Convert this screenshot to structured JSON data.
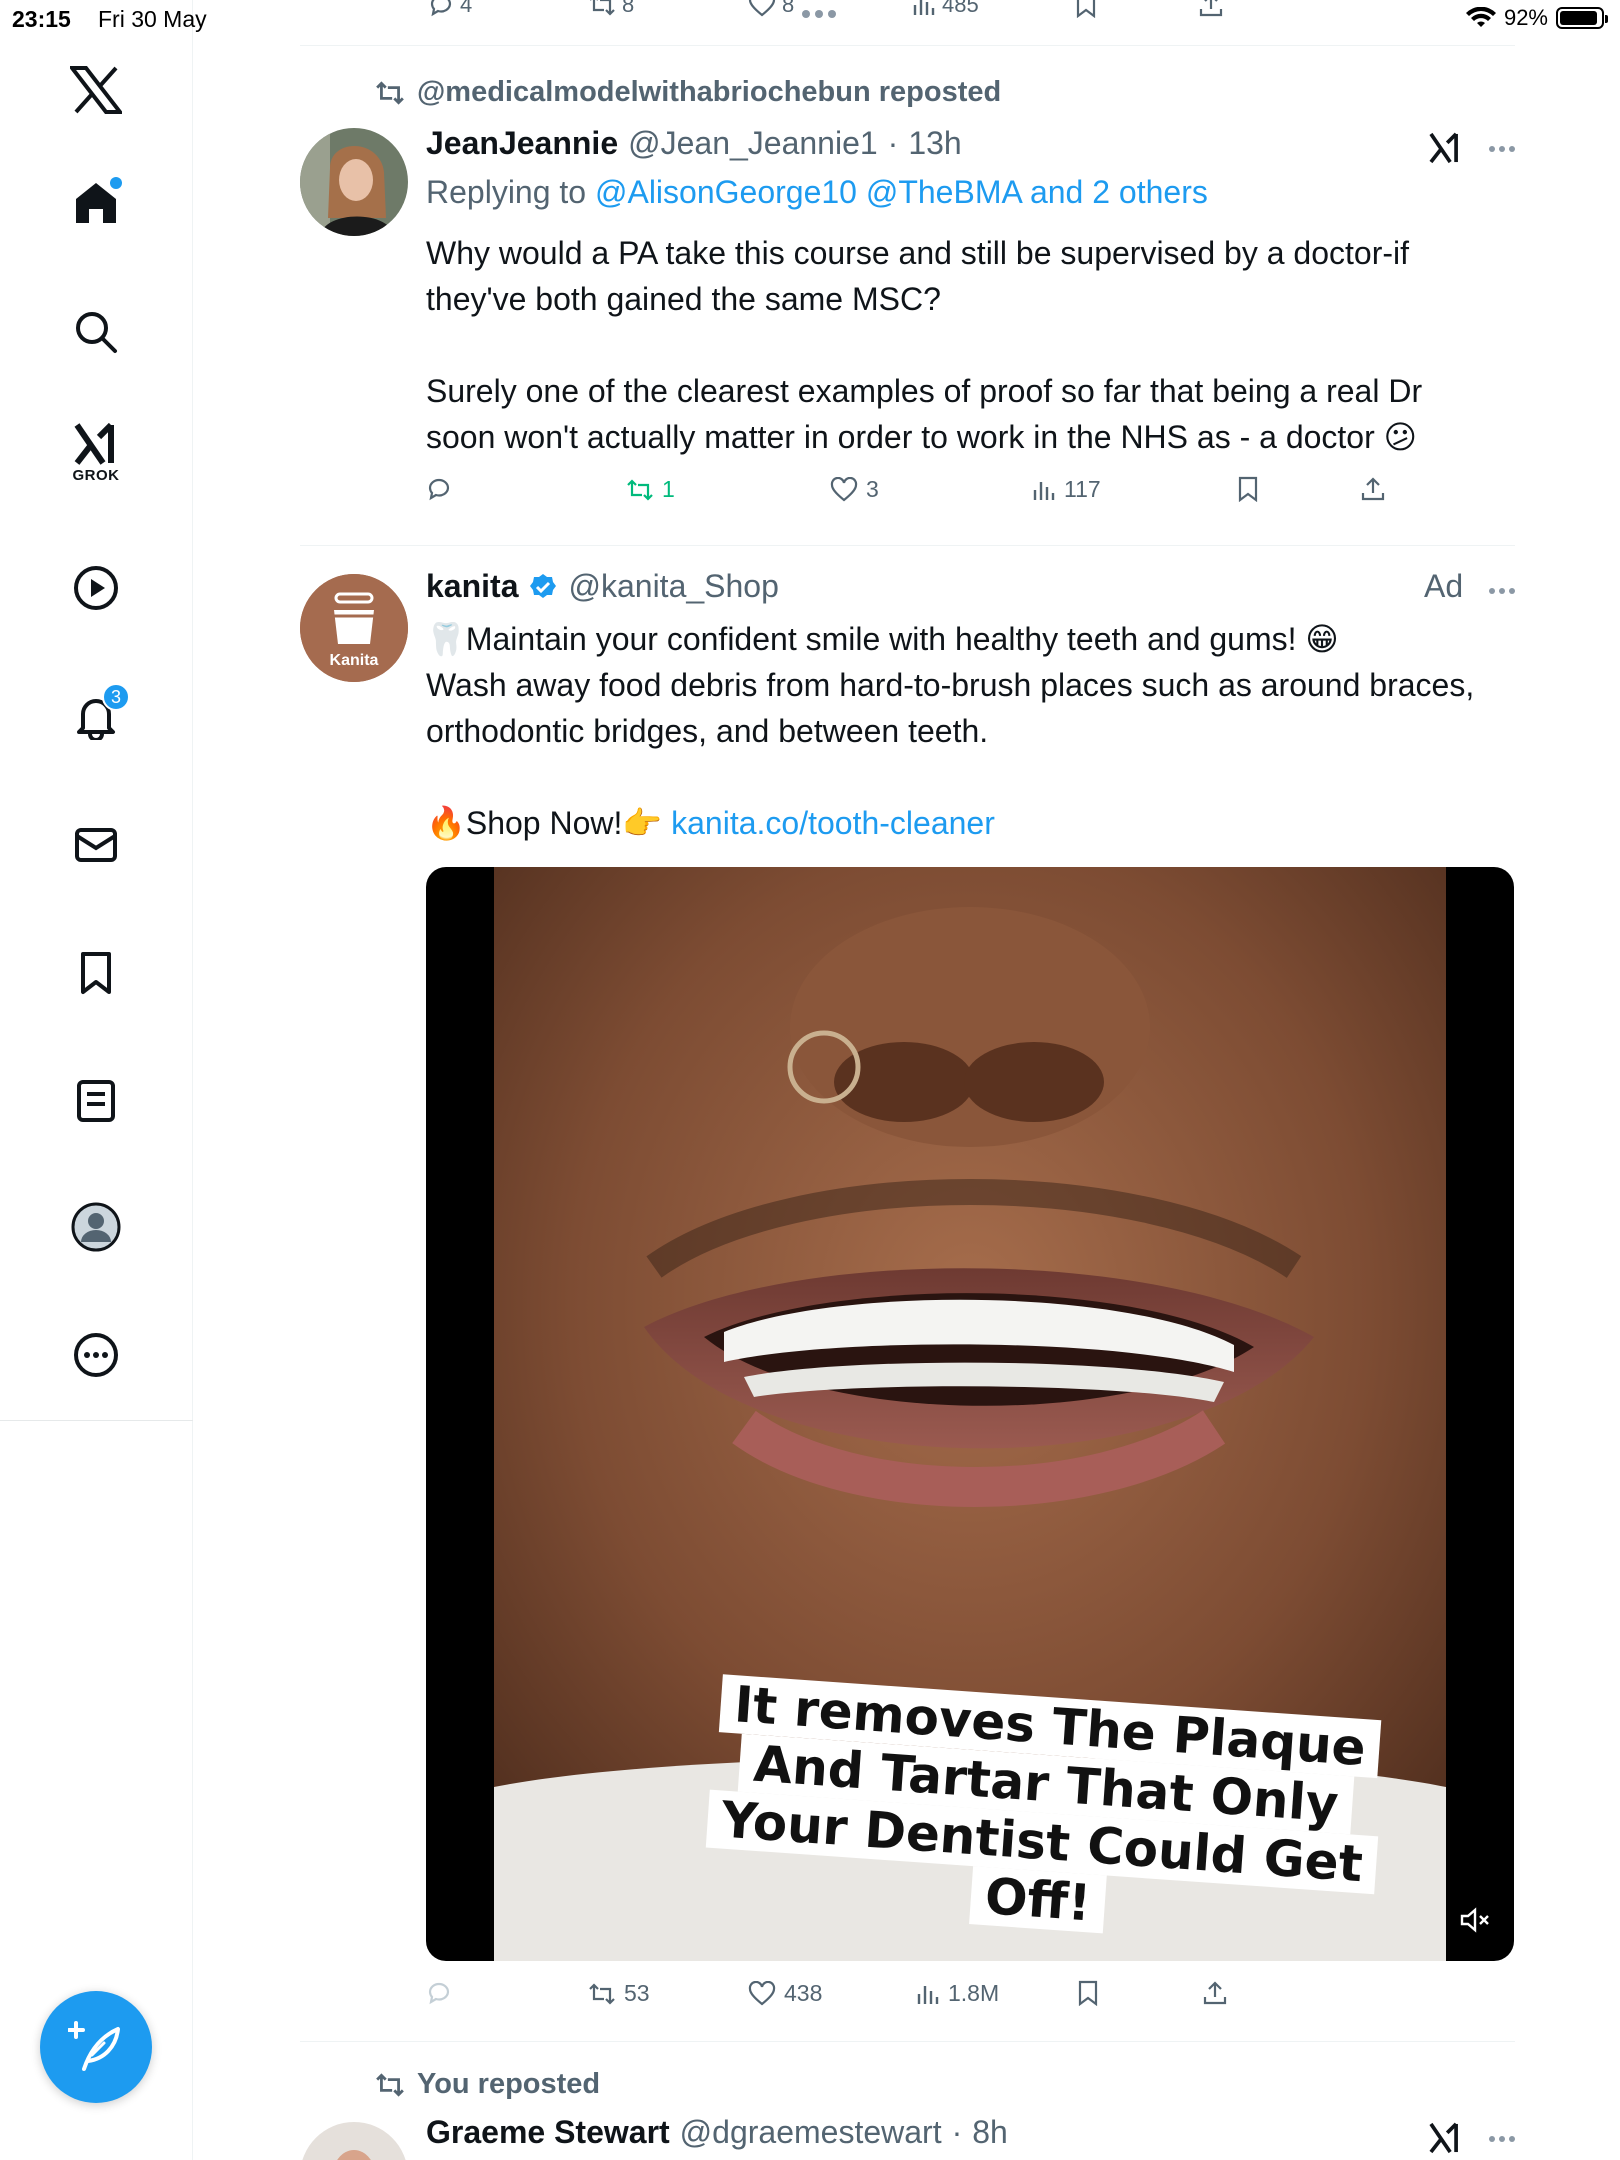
{
  "status": {
    "time": "23:15",
    "date": "Fri 30 May",
    "battery_pct": "92%",
    "battery_level": 0.92
  },
  "sidebar": {
    "grok_label": "GROK",
    "notifications_count": "3"
  },
  "previous_tweet": {
    "replies": "4",
    "reposts": "8",
    "likes": "8",
    "views": "485"
  },
  "tweet1": {
    "repost_by": "@medicalmodelwithabriochebun reposted",
    "display_name": "JeanJeannie",
    "handle": "@Jean_Jeannie1",
    "separator": "·",
    "time": "13h",
    "replying_prefix": "Replying to",
    "replying_to": "@AlisonGeorge10 @TheBMA and 2 others",
    "paragraph1": "Why would a PA take this course and still be supervised by a doctor-if they've both gained the same MSC?",
    "paragraph2": "Surely one of the clearest examples of proof so far that being a real Dr soon won't actually matter in order to work in the NHS as - a doctor 😕",
    "replies": "",
    "reposts": "1",
    "likes": "3",
    "views": "117"
  },
  "tweet2": {
    "display_name": "kanita",
    "handle": "@kanita_Shop",
    "ad_label": "Ad",
    "avatar_text": "Kanita",
    "line1": "🦷Maintain your confident smile with healthy teeth and gums! 😁",
    "line2": "Wash away food debris from hard-to-brush places such as around braces, orthodontic bridges, and between teeth.",
    "shop_now": "🔥Shop Now!👉",
    "shop_link": "kanita.co/tooth-cleaner",
    "caption": "It removes The Plaque And Tartar That Only Your Dentist Could Get Off!",
    "reposts": "53",
    "likes": "438",
    "views": "1.8M"
  },
  "tweet3": {
    "repost_by": "You reposted",
    "display_name": "Graeme Stewart",
    "handle": "@dgraemestewart",
    "separator": "·",
    "time": "8h"
  },
  "colors": {
    "accent": "#1d9bf0",
    "repost_green": "#00ba7c",
    "secondary_text": "#536471"
  }
}
